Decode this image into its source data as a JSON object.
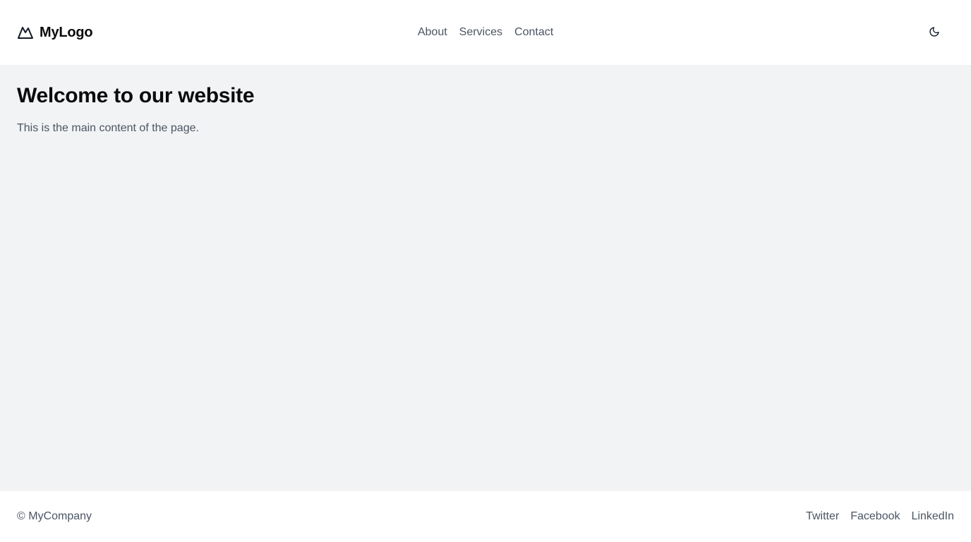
{
  "header": {
    "brand": {
      "icon": "mountain-icon",
      "label": "MyLogo"
    },
    "nav": [
      {
        "label": "About"
      },
      {
        "label": "Services"
      },
      {
        "label": "Contact"
      }
    ],
    "theme_toggle": {
      "icon": "moon-icon"
    }
  },
  "main": {
    "title": "Welcome to our website",
    "body": "This is the main content of the page."
  },
  "footer": {
    "copyright": "© MyCompany",
    "social": [
      {
        "label": "Twitter"
      },
      {
        "label": "Facebook"
      },
      {
        "label": "LinkedIn"
      }
    ]
  },
  "colors": {
    "main_background": "#f2f3f5",
    "header_background": "#ffffff",
    "text_muted": "#4b5563",
    "text_strong": "#0b0b0b"
  }
}
